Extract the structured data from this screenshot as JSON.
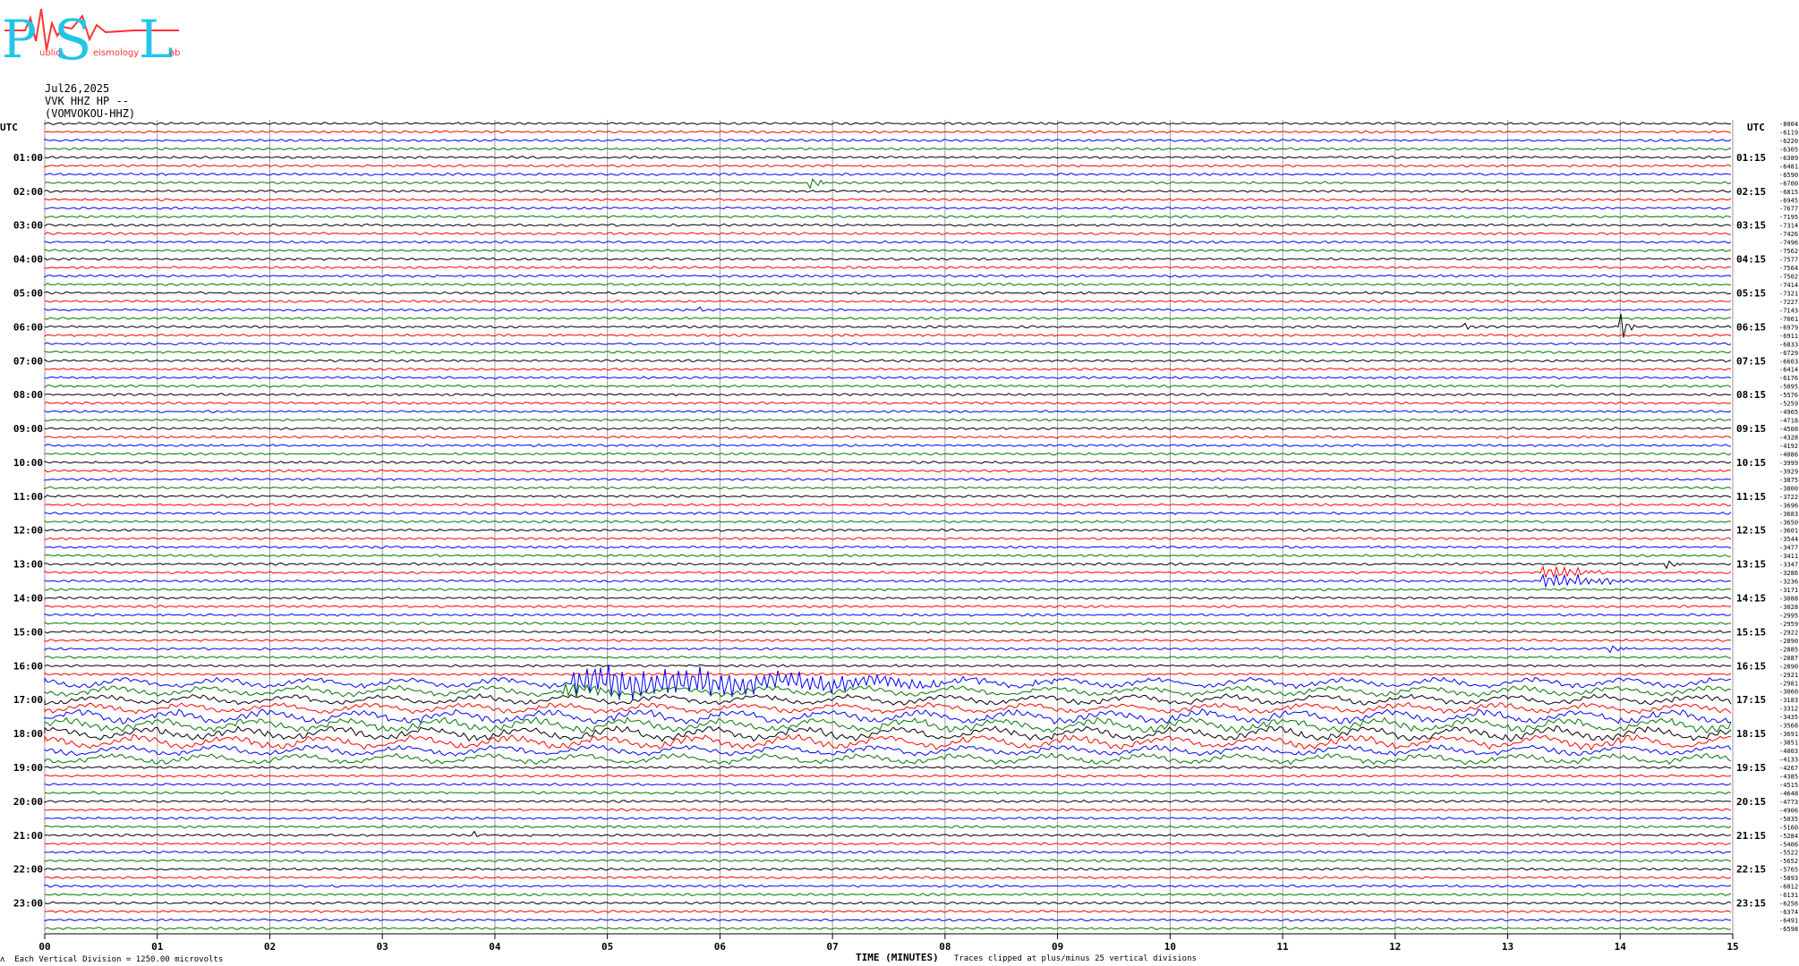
{
  "logo": {
    "letters": [
      "P",
      "S",
      "L"
    ],
    "caption_parts": [
      "ublic",
      "eismology",
      "ab"
    ],
    "red": "#ff3333",
    "cyan": "#22c4e8"
  },
  "header": {
    "date": "Jul26,2025",
    "channel": "VVK HHZ HP --",
    "station": "(VOMVOKOU-HHZ)"
  },
  "corner_labels": {
    "left": "UTC",
    "right": "UTC"
  },
  "footer": {
    "vertical_division": "Each Vertical Division = 1250.00 microvolts",
    "x_axis_title": "TIME (MINUTES)",
    "clip_note": "Traces clipped at plus/minus 25 vertical divisions"
  },
  "chart_data": {
    "type": "line",
    "description_units": "helicorder: 96 traces of 15 minutes each",
    "x_ticks": [
      "00",
      "01",
      "02",
      "03",
      "04",
      "05",
      "06",
      "07",
      "08",
      "09",
      "10",
      "11",
      "12",
      "13",
      "14",
      "15"
    ],
    "xlim": [
      0,
      15
    ],
    "left_hour_labels": [
      "01:00",
      "02:00",
      "03:00",
      "04:00",
      "05:00",
      "06:00",
      "07:00",
      "08:00",
      "09:00",
      "10:00",
      "11:00",
      "12:00",
      "13:00",
      "14:00",
      "15:00",
      "16:00",
      "17:00",
      "18:00",
      "19:00",
      "20:00",
      "21:00",
      "22:00",
      "23:00"
    ],
    "right_hour_labels": [
      "01:15",
      "02:15",
      "03:15",
      "04:15",
      "05:15",
      "06:15",
      "07:15",
      "08:15",
      "09:15",
      "10:15",
      "11:15",
      "12:15",
      "13:15",
      "14:15",
      "15:15",
      "16:15",
      "17:15",
      "18:15",
      "19:15",
      "20:15",
      "21:15",
      "22:15",
      "23:15"
    ],
    "trace_colors": [
      "#000000",
      "#ff0000",
      "#0000ff",
      "#007700"
    ],
    "grid": true,
    "trace_offsets": [
      "-8004",
      "-6119",
      "-6220",
      "-6305",
      "-6389",
      "-6481",
      "-6590",
      "-6700",
      "-6815",
      "-6945",
      "-7677",
      "-7195",
      "-7314",
      "-7426",
      "-7496",
      "-7562",
      "-7577",
      "-7564",
      "-7502",
      "-7414",
      "-7321",
      "-7227",
      "-7143",
      "-7061",
      "-6979",
      "-6911",
      "-6833",
      "-6729",
      "-6603",
      "-6414",
      "-6176",
      "-5095",
      "-5576",
      "-5259",
      "-4965",
      "-4718",
      "-4508",
      "-4328",
      "-4192",
      "-4086",
      "-3999",
      "-3929",
      "-3875",
      "-3800",
      "-3722",
      "-3696",
      "-3683",
      "-3650",
      "-3601",
      "-3544",
      "-3477",
      "-3411",
      "-3347",
      "-3286",
      "-3236",
      "-3171",
      "-3088",
      "-3028",
      "-2995",
      "-2959",
      "-2922",
      "-2890",
      "-2885",
      "-2887",
      "-2890",
      "-2921",
      "-2981",
      "-3060",
      "-3183",
      "-3312",
      "-3435",
      "-3568",
      "-3691",
      "-3851",
      "-4003",
      "-4133",
      "-4267",
      "-4385",
      "-4515",
      "-4648",
      "-4773",
      "-4906",
      "-5035",
      "-5160",
      "-5284",
      "-5406",
      "-5522",
      "-5652",
      "-5765",
      "-5893",
      "-6012",
      "-6131",
      "-6256",
      "-6374",
      "-6491",
      "-6598"
    ],
    "events": [
      {
        "trace": 7,
        "minute": 6.8,
        "amp": 8,
        "dur": 0.2,
        "note": "green"
      },
      {
        "trace": 22,
        "minute": 5.8,
        "amp": 4,
        "dur": 0.1
      },
      {
        "trace": 22,
        "minute": 11.1,
        "amp": 3,
        "dur": 0.15
      },
      {
        "trace": 24,
        "minute": 12.6,
        "amp": 6,
        "dur": 0.1
      },
      {
        "trace": 24,
        "minute": 14.0,
        "amp": 16,
        "dur": 0.15
      },
      {
        "trace": 26,
        "minute": 1.6,
        "amp": 5,
        "dur": 0.1
      },
      {
        "trace": 52,
        "minute": 14.4,
        "amp": 5,
        "dur": 0.2
      },
      {
        "trace": 53,
        "minute": 13.3,
        "amp": 10,
        "dur": 0.6
      },
      {
        "trace": 54,
        "minute": 13.3,
        "amp": 9,
        "dur": 1.0
      },
      {
        "trace": 62,
        "minute": 13.9,
        "amp": 4,
        "dur": 0.2
      },
      {
        "trace": 66,
        "minute": 4.7,
        "amp": 20,
        "dur": 4.0
      },
      {
        "trace": 67,
        "minute": 4.6,
        "amp": 9,
        "dur": 0.7
      },
      {
        "trace": 81,
        "minute": 8.4,
        "amp": 4,
        "dur": 0.1
      },
      {
        "trace": 84,
        "minute": 3.8,
        "amp": 5,
        "dur": 0.1
      }
    ]
  }
}
